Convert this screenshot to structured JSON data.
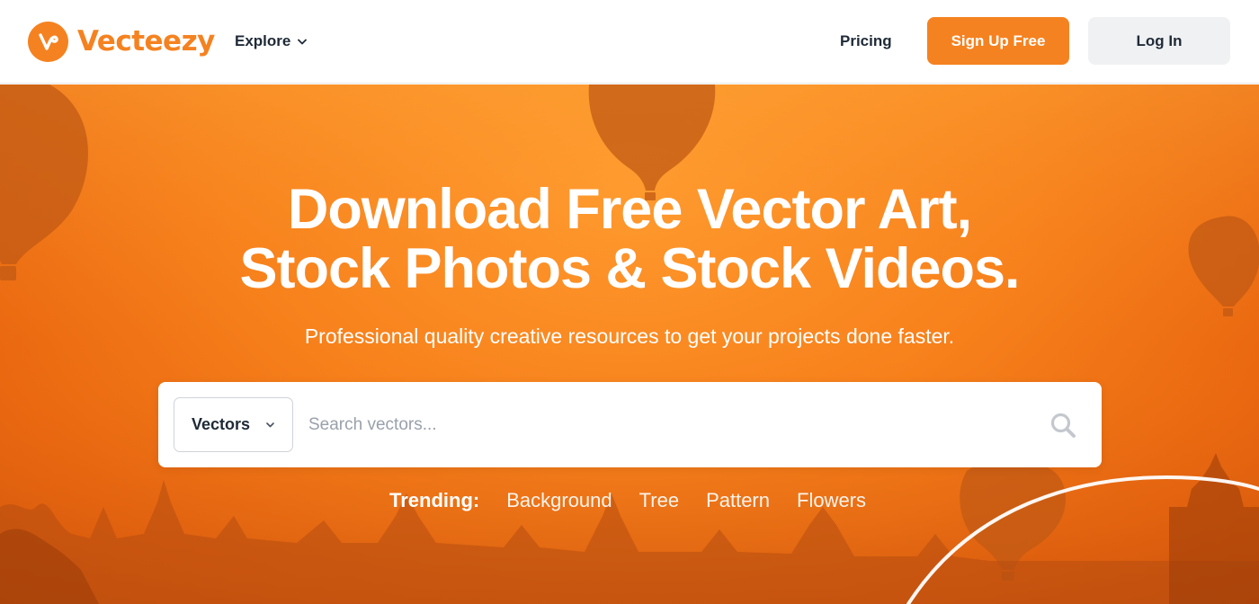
{
  "brand": {
    "name": "Vecteezy",
    "color": "#f58220"
  },
  "header": {
    "explore_label": "Explore",
    "pricing_label": "Pricing",
    "signup_label": "Sign Up Free",
    "login_label": "Log In"
  },
  "hero": {
    "headline_line1": "Download Free Vector Art,",
    "headline_line2": "Stock Photos & Stock Videos.",
    "subtitle": "Professional quality creative resources to get your projects done faster."
  },
  "search": {
    "type_selected": "Vectors",
    "placeholder": "Search vectors..."
  },
  "trending": {
    "label": "Trending:",
    "items": [
      "Background",
      "Tree",
      "Pattern",
      "Flowers"
    ]
  },
  "icons": [
    "logo-v-icon",
    "chevron-down-icon",
    "search-icon"
  ]
}
